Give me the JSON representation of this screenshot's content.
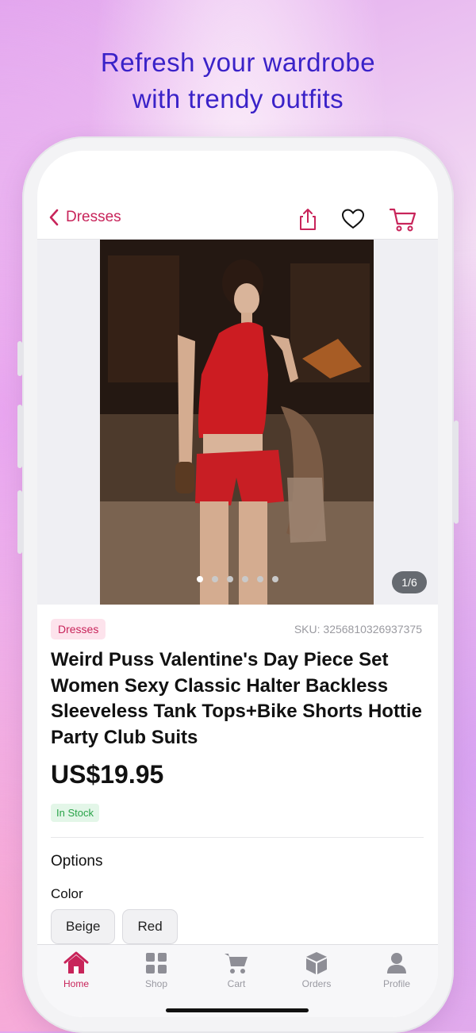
{
  "headline": [
    "Refresh your wardrobe",
    "with trendy outfits"
  ],
  "nav": {
    "back_label": "Dresses"
  },
  "gallery": {
    "counter": "1/6",
    "dot_count": 6,
    "active_dot": 0
  },
  "product": {
    "category": "Dresses",
    "sku": "SKU: 3256810326937375",
    "title": "Weird Puss Valentine's Day Piece Set Women Sexy Classic Halter Backless Sleeveless Tank Tops+Bike Shorts Hottie Party Club Suits",
    "price": "US$19.95",
    "stock": "In Stock"
  },
  "options": {
    "title": "Options",
    "color_label": "Color",
    "colors": [
      "Beige",
      "Red"
    ]
  },
  "tabs": [
    {
      "label": "Home",
      "icon": "home-icon",
      "active": true
    },
    {
      "label": "Shop",
      "icon": "grid-icon",
      "active": false
    },
    {
      "label": "Cart",
      "icon": "cart-icon",
      "active": false
    },
    {
      "label": "Orders",
      "icon": "box-icon",
      "active": false
    },
    {
      "label": "Profile",
      "icon": "person-icon",
      "active": false
    }
  ],
  "colors": {
    "accent": "#c8245a",
    "headline": "#3a22c8",
    "in_stock": "#29a348"
  }
}
